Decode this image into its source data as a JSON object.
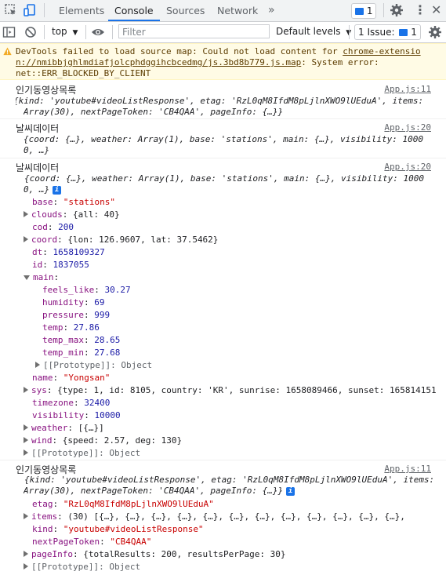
{
  "tabs": [
    "Elements",
    "Console",
    "Sources",
    "Network"
  ],
  "messages_badge": "1",
  "toolbar": {
    "context": "top",
    "filter_placeholder": "Filter",
    "levels": "Default levels",
    "issues": "1 Issue:",
    "issues_count": "1"
  },
  "warning": {
    "l1a": "DevTools failed to load source map: Could not load content for ",
    "l1b": "chrome-extensio",
    "l2a": "n://nmibbjghlmdiafjolcphdggihcbcedmg/js.3bd8b779.js.map",
    "l2b": ": System error:",
    "l3": "net::ERR_BLOCKED_BY_CLIENT"
  },
  "log1": {
    "title": "인기동영상목록",
    "src": "App.js:11",
    "l1": "{kind: 'youtube#videoListResponse', etag: 'RzL0qM8IfdM8pLjlnXWO9lUEduA', items:",
    "l2": "Array(30), nextPageToken: 'CB4QAA', pageInfo: {…}}"
  },
  "log2": {
    "title": "날씨데이터",
    "src": "App.js:20",
    "l1": "{coord: {…}, weather: Array(1), base: 'stations', main: {…}, visibility: 1000",
    "l2": "0, …}"
  },
  "log3": {
    "title": "날씨데이터",
    "src": "App.js:20",
    "l1": "{coord: {…}, weather: Array(1), base: 'stations', main: {…}, visibility: 1000",
    "l2": "0, …}",
    "props": {
      "base": "\"stations\"",
      "clouds": "{all: 40}",
      "cod": "200",
      "coord": "{lon: 126.9607, lat: 37.5462}",
      "dt": "1658109327",
      "id": "1837055",
      "feels_like": "30.27",
      "humidity": "69",
      "pressure": "999",
      "temp": "27.86",
      "temp_max": "28.65",
      "temp_min": "27.68",
      "prototype": "[[Prototype]]: Object",
      "name": "\"Yongsan\"",
      "sys": "{type: 1, id: 8105, country: 'KR', sunrise: 1658089466, sunset: 165814151",
      "timezone": "32400",
      "visibility": "10000",
      "weather": "[{…}]",
      "wind": "{speed: 2.57, deg: 130}"
    }
  },
  "log4": {
    "title": "인기동영상목록",
    "src": "App.js:11",
    "l1": "{kind: 'youtube#videoListResponse', etag: 'RzL0qM8IfdM8pLjlnXWO9lUEduA', items:",
    "l2": "Array(30), nextPageToken: 'CB4QAA', pageInfo: {…}}",
    "etag": "\"RzL0qM8IfdM8pLjlnXWO9lUEduA\"",
    "items": "(30) [{…}, {…}, {…}, {…}, {…}, {…}, {…}, {…}, {…}, {…}, {…}, {…},",
    "kind": "\"youtube#videoListResponse\"",
    "nextPageToken": "\"CB4QAA\"",
    "pageInfo": "{totalResults: 200, resultsPerPage: 30}",
    "prototype": "[[Prototype]]: Object"
  }
}
